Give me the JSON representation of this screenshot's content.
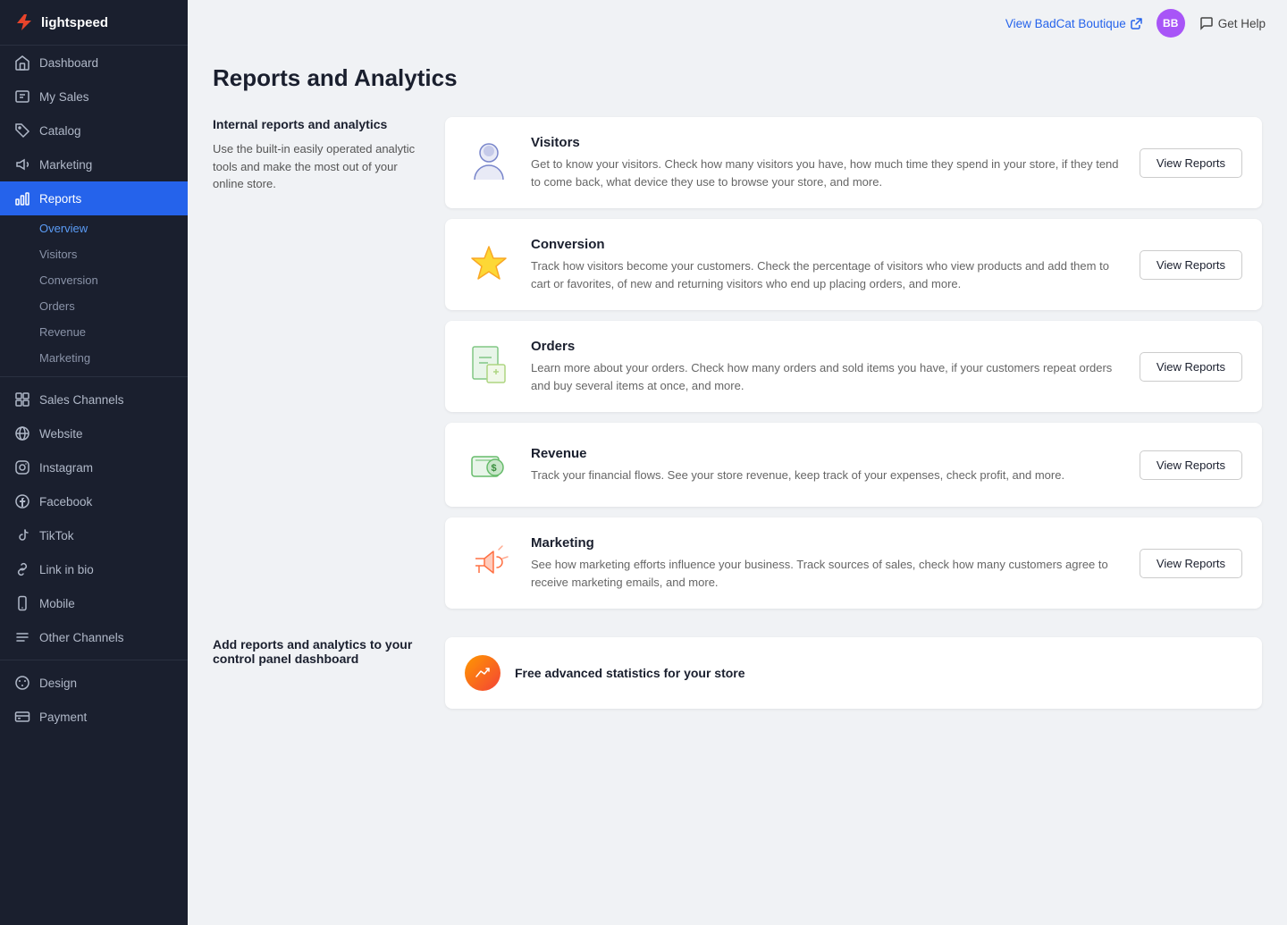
{
  "app": {
    "name": "lightspeed"
  },
  "topbar": {
    "store_link": "View BadCat Boutique",
    "avatar_initials": "BB",
    "help_label": "Get Help"
  },
  "page": {
    "title": "Reports and Analytics"
  },
  "internal_section": {
    "heading": "Internal reports and analytics",
    "description": "Use the built-in easily operated analytic tools and make the most out of your online store."
  },
  "report_cards": [
    {
      "id": "visitors",
      "title": "Visitors",
      "description": "Get to know your visitors. Check how many visitors you have, how much time they spend in your store, if they tend to come back, what device they use to browse your store, and more.",
      "button_label": "View Reports",
      "icon": "visitor"
    },
    {
      "id": "conversion",
      "title": "Conversion",
      "description": "Track how visitors become your customers. Check the percentage of visitors who view products and add them to cart or favorites, of new and returning visitors who end up placing orders, and more.",
      "button_label": "View Reports",
      "icon": "star"
    },
    {
      "id": "orders",
      "title": "Orders",
      "description": "Learn more about your orders. Check how many orders and sold items you have, if your customers repeat orders and buy several items at once, and more.",
      "button_label": "View Reports",
      "icon": "orders"
    },
    {
      "id": "revenue",
      "title": "Revenue",
      "description": "Track your financial flows. See your store revenue, keep track of your expenses, check profit, and more.",
      "button_label": "View Reports",
      "icon": "revenue"
    },
    {
      "id": "marketing",
      "title": "Marketing",
      "description": "See how marketing efforts influence your business. Track sources of sales, check how many customers agree to receive marketing emails, and more.",
      "button_label": "View Reports",
      "icon": "marketing"
    }
  ],
  "bottom_section": {
    "heading": "Add reports and analytics to your control panel dashboard",
    "description": "",
    "card_title": "Free advanced statistics for your store"
  },
  "sidebar": {
    "logo_text": "lightspeed",
    "nav_items": [
      {
        "id": "dashboard",
        "label": "Dashboard",
        "icon": "home"
      },
      {
        "id": "my-sales",
        "label": "My Sales",
        "icon": "sales"
      },
      {
        "id": "catalog",
        "label": "Catalog",
        "icon": "tag"
      },
      {
        "id": "marketing",
        "label": "Marketing",
        "icon": "megaphone"
      },
      {
        "id": "reports",
        "label": "Reports",
        "icon": "chart",
        "active": true
      }
    ],
    "sub_items": [
      {
        "id": "overview",
        "label": "Overview",
        "active": true
      },
      {
        "id": "visitors",
        "label": "Visitors"
      },
      {
        "id": "conversion",
        "label": "Conversion"
      },
      {
        "id": "orders",
        "label": "Orders"
      },
      {
        "id": "revenue",
        "label": "Revenue"
      },
      {
        "id": "marketing-sub",
        "label": "Marketing"
      }
    ],
    "channel_items": [
      {
        "id": "sales-channels",
        "label": "Sales Channels",
        "icon": "grid"
      },
      {
        "id": "website",
        "label": "Website",
        "icon": "globe"
      },
      {
        "id": "instagram",
        "label": "Instagram",
        "icon": "instagram"
      },
      {
        "id": "facebook",
        "label": "Facebook",
        "icon": "facebook"
      },
      {
        "id": "tiktok",
        "label": "TikTok",
        "icon": "tiktok"
      },
      {
        "id": "link-in-bio",
        "label": "Link in bio",
        "icon": "link"
      },
      {
        "id": "mobile",
        "label": "Mobile",
        "icon": "mobile"
      },
      {
        "id": "other-channels",
        "label": "Other Channels",
        "icon": "other"
      }
    ],
    "bottom_items": [
      {
        "id": "design",
        "label": "Design",
        "icon": "palette"
      },
      {
        "id": "payment",
        "label": "Payment",
        "icon": "payment"
      }
    ]
  }
}
